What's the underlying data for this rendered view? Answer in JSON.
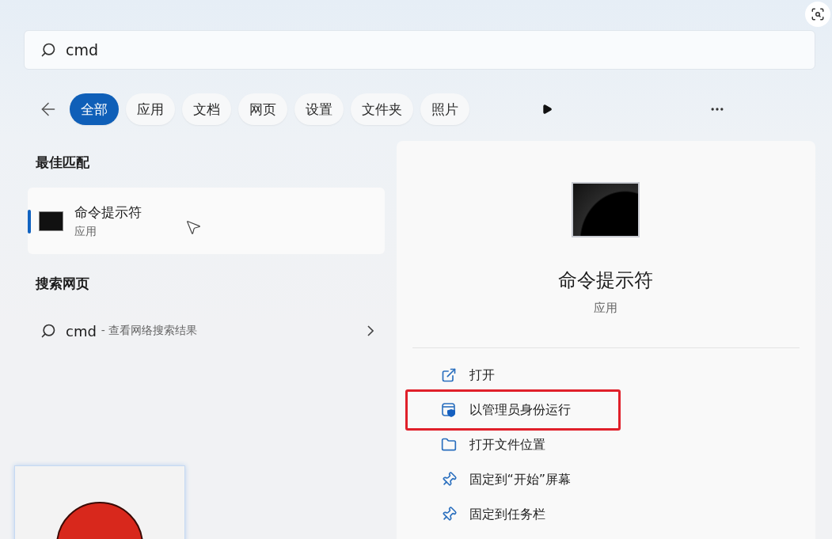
{
  "search": {
    "value": "cmd"
  },
  "filters": [
    {
      "label": "全部",
      "selected": true
    },
    {
      "label": "应用",
      "selected": false
    },
    {
      "label": "文档",
      "selected": false
    },
    {
      "label": "网页",
      "selected": false
    },
    {
      "label": "设置",
      "selected": false
    },
    {
      "label": "文件夹",
      "selected": false
    },
    {
      "label": "照片",
      "selected": false
    }
  ],
  "best_match": {
    "heading": "最佳匹配",
    "name": "命令提示符",
    "type": "应用",
    "selected": true
  },
  "web_search": {
    "heading": "搜索网页",
    "query": "cmd",
    "hint": "- 查看网络搜索结果"
  },
  "detail": {
    "name": "命令提示符",
    "type": "应用",
    "actions": [
      {
        "kind": "open",
        "label": "打开",
        "highlighted": false
      },
      {
        "kind": "admin",
        "label": "以管理员身份运行",
        "highlighted": true
      },
      {
        "kind": "folder",
        "label": "打开文件位置",
        "highlighted": false
      },
      {
        "kind": "pin",
        "label": "固定到“开始”屏幕",
        "highlighted": false
      },
      {
        "kind": "pin",
        "label": "固定到任务栏",
        "highlighted": false
      }
    ]
  }
}
